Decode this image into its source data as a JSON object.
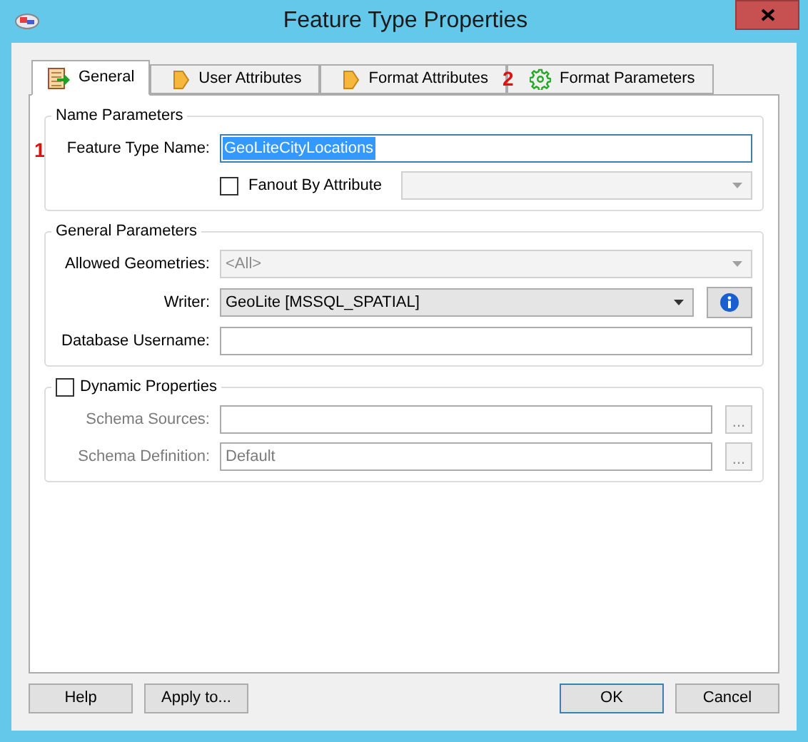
{
  "window": {
    "title": "Feature Type Properties"
  },
  "tabs": [
    {
      "label": "General",
      "selected": true,
      "kind": "table"
    },
    {
      "label": "User Attributes",
      "selected": false,
      "kind": "tag"
    },
    {
      "label": "Format Attributes",
      "selected": false,
      "kind": "tag"
    },
    {
      "label": "Format Parameters",
      "selected": false,
      "kind": "gear",
      "annotation": "2"
    }
  ],
  "name_parameters": {
    "title": "Name Parameters",
    "annotation": "1",
    "feature_type_name": {
      "label": "Feature Type Name:",
      "value": "GeoLiteCityLocations",
      "text_selected": true
    },
    "fanout": {
      "label": "Fanout By Attribute",
      "checked": false,
      "combo_disabled": true
    }
  },
  "general_parameters": {
    "title": "General Parameters",
    "rows": [
      {
        "kind": "combo",
        "label": "Allowed Geometries:",
        "value": "<All>",
        "disabled": true
      },
      {
        "kind": "combo",
        "label": "Writer:",
        "value": "GeoLite [MSSQL_SPATIAL]",
        "disabled": false,
        "info": true
      },
      {
        "kind": "text",
        "label": "Database Username:"
      }
    ]
  },
  "dynamic_properties": {
    "label": "Dynamic Properties",
    "checked": false,
    "rows": [
      {
        "label": "Schema Sources:",
        "browse": "...",
        "disabled": true
      },
      {
        "label": "Schema Definition:",
        "value": "Default",
        "browse": "...",
        "disabled": true
      }
    ]
  },
  "left_buttons": [
    {
      "label": "Help",
      "default": false
    },
    {
      "label": "Apply to...",
      "default": false
    }
  ],
  "right_buttons": [
    {
      "label": "OK",
      "default": true
    },
    {
      "label": "Cancel",
      "default": false
    }
  ]
}
